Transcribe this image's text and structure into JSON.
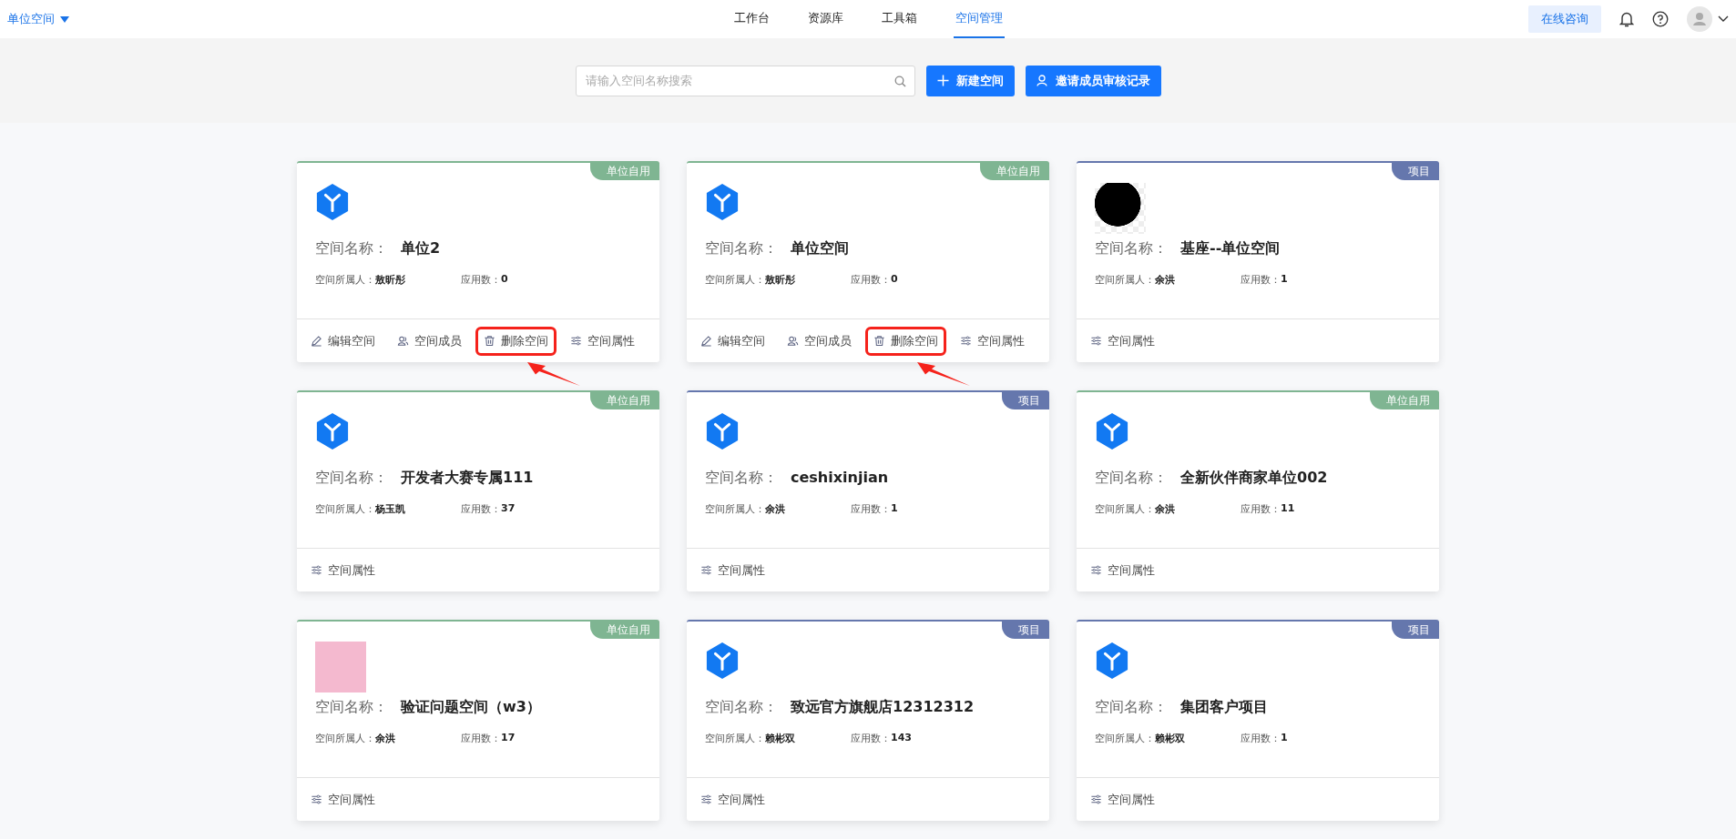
{
  "header": {
    "space_switcher": "单位空间",
    "nav": [
      {
        "label": "工作台",
        "selected": false
      },
      {
        "label": "资源库",
        "selected": false
      },
      {
        "label": "工具箱",
        "selected": false
      },
      {
        "label": "空间管理",
        "selected": true
      }
    ],
    "consult_button": "在线咨询"
  },
  "toolbar": {
    "search": {
      "placeholder": "请输入空间名称搜索"
    },
    "buttons": [
      {
        "kind": "add",
        "label": "新建空间"
      },
      {
        "kind": "invite",
        "label": "邀请成员审核记录"
      }
    ]
  },
  "cards": [
    {
      "tag": {
        "label": "单位自用",
        "color": "#7fb592"
      },
      "logo": {
        "kind": "cube"
      },
      "name_label": "空间名称：",
      "name": "单位2",
      "owner_label": "空间所属人：",
      "owner": "敖昕彤",
      "apps_label": "应用数：",
      "apps": "0",
      "actions": [
        {
          "kind": "edit",
          "label": "编辑空间",
          "highlighted": false
        },
        {
          "kind": "members",
          "label": "空间成员",
          "highlighted": false
        },
        {
          "kind": "delete",
          "label": "删除空间",
          "highlighted": true
        },
        {
          "kind": "properties",
          "label": "空间属性",
          "highlighted": false
        }
      ]
    },
    {
      "tag": {
        "label": "单位自用",
        "color": "#7fb592"
      },
      "logo": {
        "kind": "cube"
      },
      "name_label": "空间名称：",
      "name": "单位空间",
      "owner_label": "空间所属人：",
      "owner": "敖昕彤",
      "apps_label": "应用数：",
      "apps": "0",
      "actions": [
        {
          "kind": "edit",
          "label": "编辑空间",
          "highlighted": false
        },
        {
          "kind": "members",
          "label": "空间成员",
          "highlighted": false
        },
        {
          "kind": "delete",
          "label": "删除空间",
          "highlighted": true
        },
        {
          "kind": "properties",
          "label": "空间属性",
          "highlighted": false
        }
      ]
    },
    {
      "tag": {
        "label": "项目",
        "color": "#6577ad"
      },
      "logo": {
        "kind": "sticker"
      },
      "name_label": "空间名称：",
      "name": "基座--单位空间",
      "owner_label": "空间所属人：",
      "owner": "余洪",
      "apps_label": "应用数：",
      "apps": "1",
      "actions": [
        {
          "kind": "properties",
          "label": "空间属性",
          "highlighted": false
        }
      ]
    },
    {
      "tag": {
        "label": "单位自用",
        "color": "#7fb592"
      },
      "logo": {
        "kind": "cube"
      },
      "name_label": "空间名称：",
      "name": "开发者大赛专属111",
      "owner_label": "空间所属人：",
      "owner": "杨玉凯",
      "apps_label": "应用数：",
      "apps": "37",
      "actions": [
        {
          "kind": "properties",
          "label": "空间属性",
          "highlighted": false
        }
      ]
    },
    {
      "tag": {
        "label": "项目",
        "color": "#6577ad"
      },
      "logo": {
        "kind": "cube"
      },
      "name_label": "空间名称：",
      "name": "ceshixinjian",
      "owner_label": "空间所属人：",
      "owner": "余洪",
      "apps_label": "应用数：",
      "apps": "1",
      "actions": [
        {
          "kind": "properties",
          "label": "空间属性",
          "highlighted": false
        }
      ]
    },
    {
      "tag": {
        "label": "单位自用",
        "color": "#7fb592"
      },
      "logo": {
        "kind": "cube"
      },
      "name_label": "空间名称：",
      "name": "全新伙伴商家单位002",
      "owner_label": "空间所属人：",
      "owner": "余洪",
      "apps_label": "应用数：",
      "apps": "11",
      "actions": [
        {
          "kind": "properties",
          "label": "空间属性",
          "highlighted": false
        }
      ]
    },
    {
      "tag": {
        "label": "单位自用",
        "color": "#7fb592"
      },
      "logo": {
        "kind": "pattern"
      },
      "name_label": "空间名称：",
      "name": "验证问题空间（w3）",
      "owner_label": "空间所属人：",
      "owner": "余洪",
      "apps_label": "应用数：",
      "apps": "17",
      "actions": [
        {
          "kind": "properties",
          "label": "空间属性",
          "highlighted": false
        }
      ]
    },
    {
      "tag": {
        "label": "项目",
        "color": "#6577ad"
      },
      "logo": {
        "kind": "cube"
      },
      "name_label": "空间名称：",
      "name": "致远官方旗舰店12312312",
      "owner_label": "空间所属人：",
      "owner": "赖彬双",
      "apps_label": "应用数：",
      "apps": "143",
      "actions": [
        {
          "kind": "properties",
          "label": "空间属性",
          "highlighted": false
        }
      ]
    },
    {
      "tag": {
        "label": "项目",
        "color": "#6577ad"
      },
      "logo": {
        "kind": "cube"
      },
      "name_label": "空间名称：",
      "name": "集团客户项目",
      "owner_label": "空间所属人：",
      "owner": "赖彬双",
      "apps_label": "应用数：",
      "apps": "1",
      "actions": [
        {
          "kind": "properties",
          "label": "空间属性",
          "highlighted": false
        }
      ]
    }
  ]
}
